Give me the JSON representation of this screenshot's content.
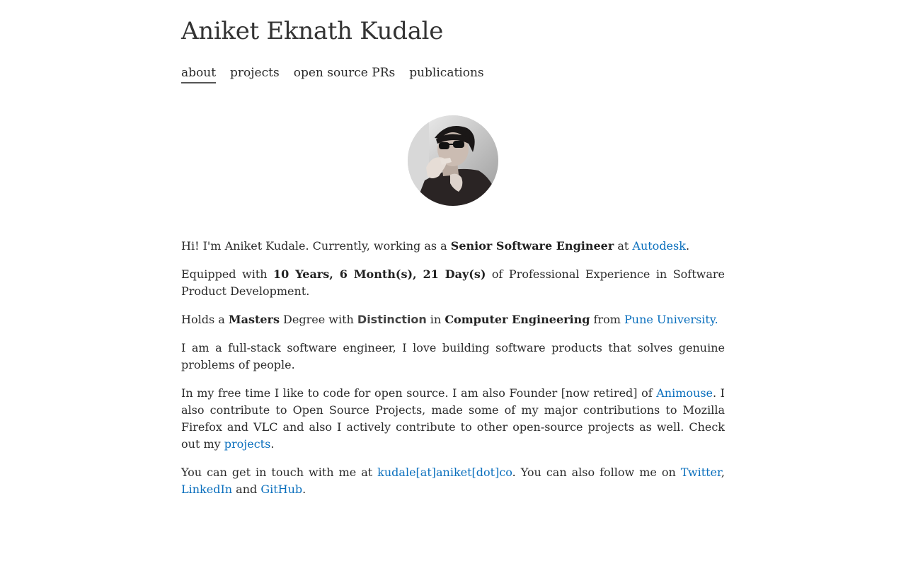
{
  "header": {
    "name": "Aniket Eknath Kudale"
  },
  "nav": {
    "items": [
      {
        "label": "about",
        "active": true
      },
      {
        "label": "projects",
        "active": false
      },
      {
        "label": "open source PRs",
        "active": false
      },
      {
        "label": "publications",
        "active": false
      }
    ]
  },
  "profile": {
    "avatar_icon": "profile-photo"
  },
  "about": {
    "p1": {
      "pre": "Hi! I'm Aniket Kudale. Currently, working as a ",
      "role": "Senior Software Engineer",
      "mid": " at ",
      "company_link": "Autodesk",
      "post": "."
    },
    "p2": {
      "pre": "Equipped with ",
      "experience": "10 Years, 6 Month(s), 21 Day(s)",
      "post": " of Professional Experience in Software Product Development."
    },
    "p3": {
      "pre": "Holds a ",
      "degree": "Masters",
      "mid1": " Degree with ",
      "distinction": "Distinction",
      "mid2": " in ",
      "field": "Computer Engineering",
      "mid3": " from ",
      "university_link": "Pune University."
    },
    "p4": {
      "text": "I am a full-stack software engineer, I love building software products that solves genuine problems of people."
    },
    "p5": {
      "pre": "In my free time I like to code for open source. I am also Founder [now retired] of ",
      "animouse_link": "Animouse",
      "mid": ". I also contribute to Open Source Projects, made some of my major contributions to Mozilla Firefox and VLC and also I actively contribute to other open-source projects as well. Check out my ",
      "projects_link": "projects",
      "post": "."
    },
    "p6": {
      "pre": "You can get in touch with me at ",
      "email_link": "kudale[at]aniket[dot]co",
      "mid": ". You can also follow me on ",
      "twitter_link": "Twitter",
      "comma": ", ",
      "linkedin_link": "LinkedIn",
      "and": " and ",
      "github_link": "GitHub",
      "post": "."
    }
  },
  "colors": {
    "link": "#0a6fbd",
    "text": "#2b2b2b",
    "background": "#ffffff"
  }
}
